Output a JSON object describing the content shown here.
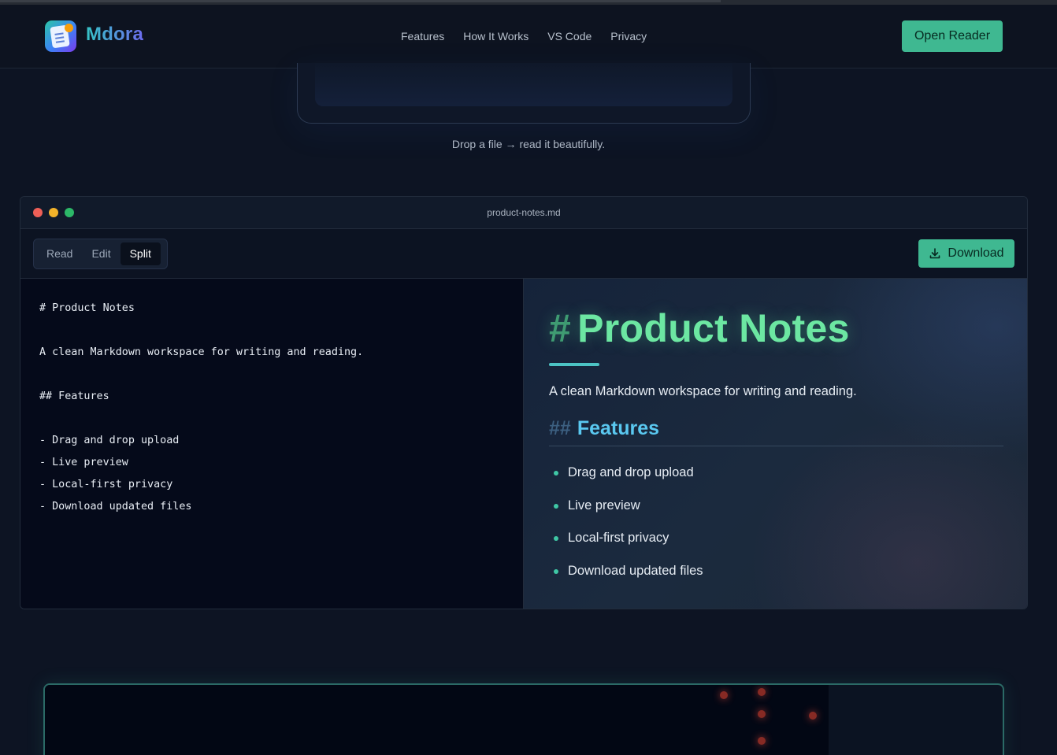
{
  "header": {
    "brand": "Mdora",
    "nav": [
      "Features",
      "How It Works",
      "VS Code",
      "Privacy"
    ],
    "cta": "Open Reader"
  },
  "upload": {
    "caption": "Drop a file → read it beautifully."
  },
  "window": {
    "filename": "product-notes.md",
    "modes": [
      "Read",
      "Edit",
      "Split"
    ],
    "active_mode": "Split",
    "download_label": "Download"
  },
  "editor": {
    "lines": [
      "# Product Notes",
      "",
      "A clean Markdown workspace for writing and reading.",
      "",
      "## Features",
      "",
      "- Drag and drop upload",
      "- Live preview",
      "- Local-first privacy",
      "- Download updated files"
    ]
  },
  "preview": {
    "h1_hash": "#",
    "h1": "Product Notes",
    "paragraph": "A clean Markdown workspace for writing and reading.",
    "h2_hash": "##",
    "h2": "Features",
    "items": [
      "Drag and drop upload",
      "Live preview",
      "Local-first privacy",
      "Download updated files"
    ]
  },
  "colors": {
    "accent": "#3fb891",
    "h1": "#6ce7a2",
    "h2": "#5ac8f0",
    "background": "#0d1423"
  }
}
